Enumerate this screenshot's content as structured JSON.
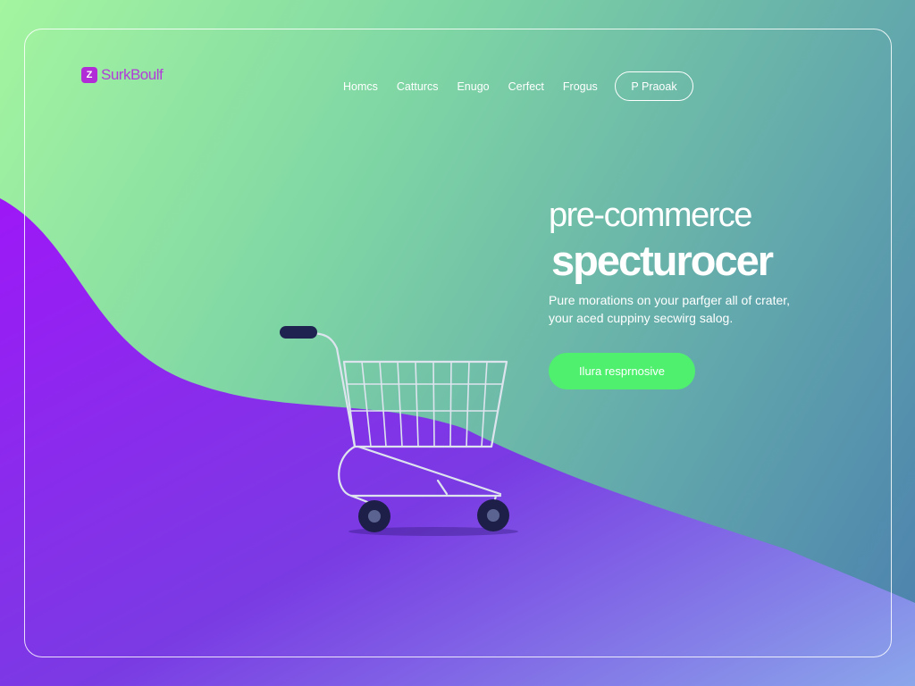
{
  "brand": {
    "mark": "Z",
    "name": "SurkBoulf"
  },
  "nav": {
    "items": [
      "Homcs",
      "Catturcs",
      "Enugo",
      "Cerfect",
      "Frogus"
    ],
    "cta": "P Praoak"
  },
  "hero": {
    "title_line1": "pre-commerce",
    "title_line2": "specturocer",
    "subtitle": "Pure morations on your parfger all of crater, your aced cuppiny secwirg salog.",
    "cta": "Ilura resprnosive"
  },
  "illustration": {
    "icon": "shopping-cart-icon"
  },
  "colors": {
    "gradient_green": "#a4f5a0",
    "gradient_blue": "#4b7fae",
    "wave_purple": "#8a2be8",
    "cta_green": "#4ff06e",
    "brand_purple": "#b23dd8"
  }
}
